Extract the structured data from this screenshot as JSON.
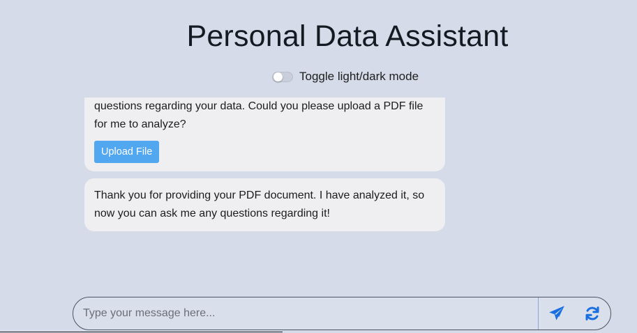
{
  "app": {
    "title": "Personal Data Assistant"
  },
  "theme_toggle": {
    "label": "Toggle light/dark mode",
    "state": "off"
  },
  "messages": [
    {
      "sender": "assistant",
      "text": "questions regarding your data. Could you please upload a PDF file for me to analyze?",
      "button_label": "Upload File"
    },
    {
      "sender": "assistant",
      "text": "Thank you for providing your PDF document. I have analyzed it, so now you can ask me any questions regarding it!"
    }
  ],
  "composer": {
    "placeholder": "Type your message here...",
    "value": "",
    "send_icon": "paper-plane-icon",
    "reset_icon": "refresh-icon"
  },
  "colors": {
    "background": "#d5dbe8",
    "bubble": "#efeff1",
    "button": "#52a7f1",
    "icon": "#1a6fe0"
  }
}
